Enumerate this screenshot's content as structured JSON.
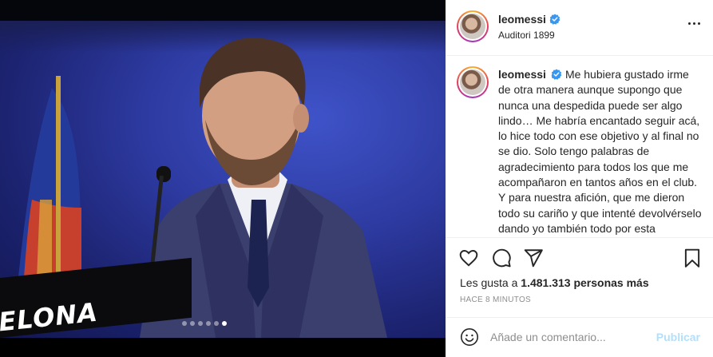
{
  "post": {
    "photo": {
      "lectern_text": "ELONA",
      "carousel": {
        "count": 6,
        "active_index": 5
      }
    },
    "header": {
      "username": "leomessi",
      "location": "Auditori 1899"
    },
    "caption": {
      "username": "leomessi",
      "text": "Me hubiera gustado irme de otra manera aunque supongo que nunca una despedida puede ser algo lindo… Me habría encantado seguir acá, lo hice todo con ese objetivo y al final no se dio. Solo tengo palabras de agradecimiento para todos los que me acompañaron en tantos años en el club. Y para nuestra afición, que me dieron todo su cariño y que intenté devolvérselo dando yo también todo por esta camiseta. Me"
    },
    "likes": {
      "prefix": "Les gusta a",
      "count": "1.481.313",
      "suffix": "personas más"
    },
    "timestamp": "HACE 8 MINUTOS",
    "composer": {
      "placeholder": "Añade un comentario...",
      "submit_label": "Publicar"
    },
    "icons": [
      "more-options-icon",
      "verified-badge-icon",
      "heart-icon",
      "comment-icon",
      "share-icon",
      "bookmark-icon",
      "emoji-icon"
    ],
    "colors": {
      "verified": "#3897f0",
      "submit_disabled": "#b2dffc",
      "secondary_text": "#8e8e8e",
      "primary_text": "#262626"
    }
  }
}
